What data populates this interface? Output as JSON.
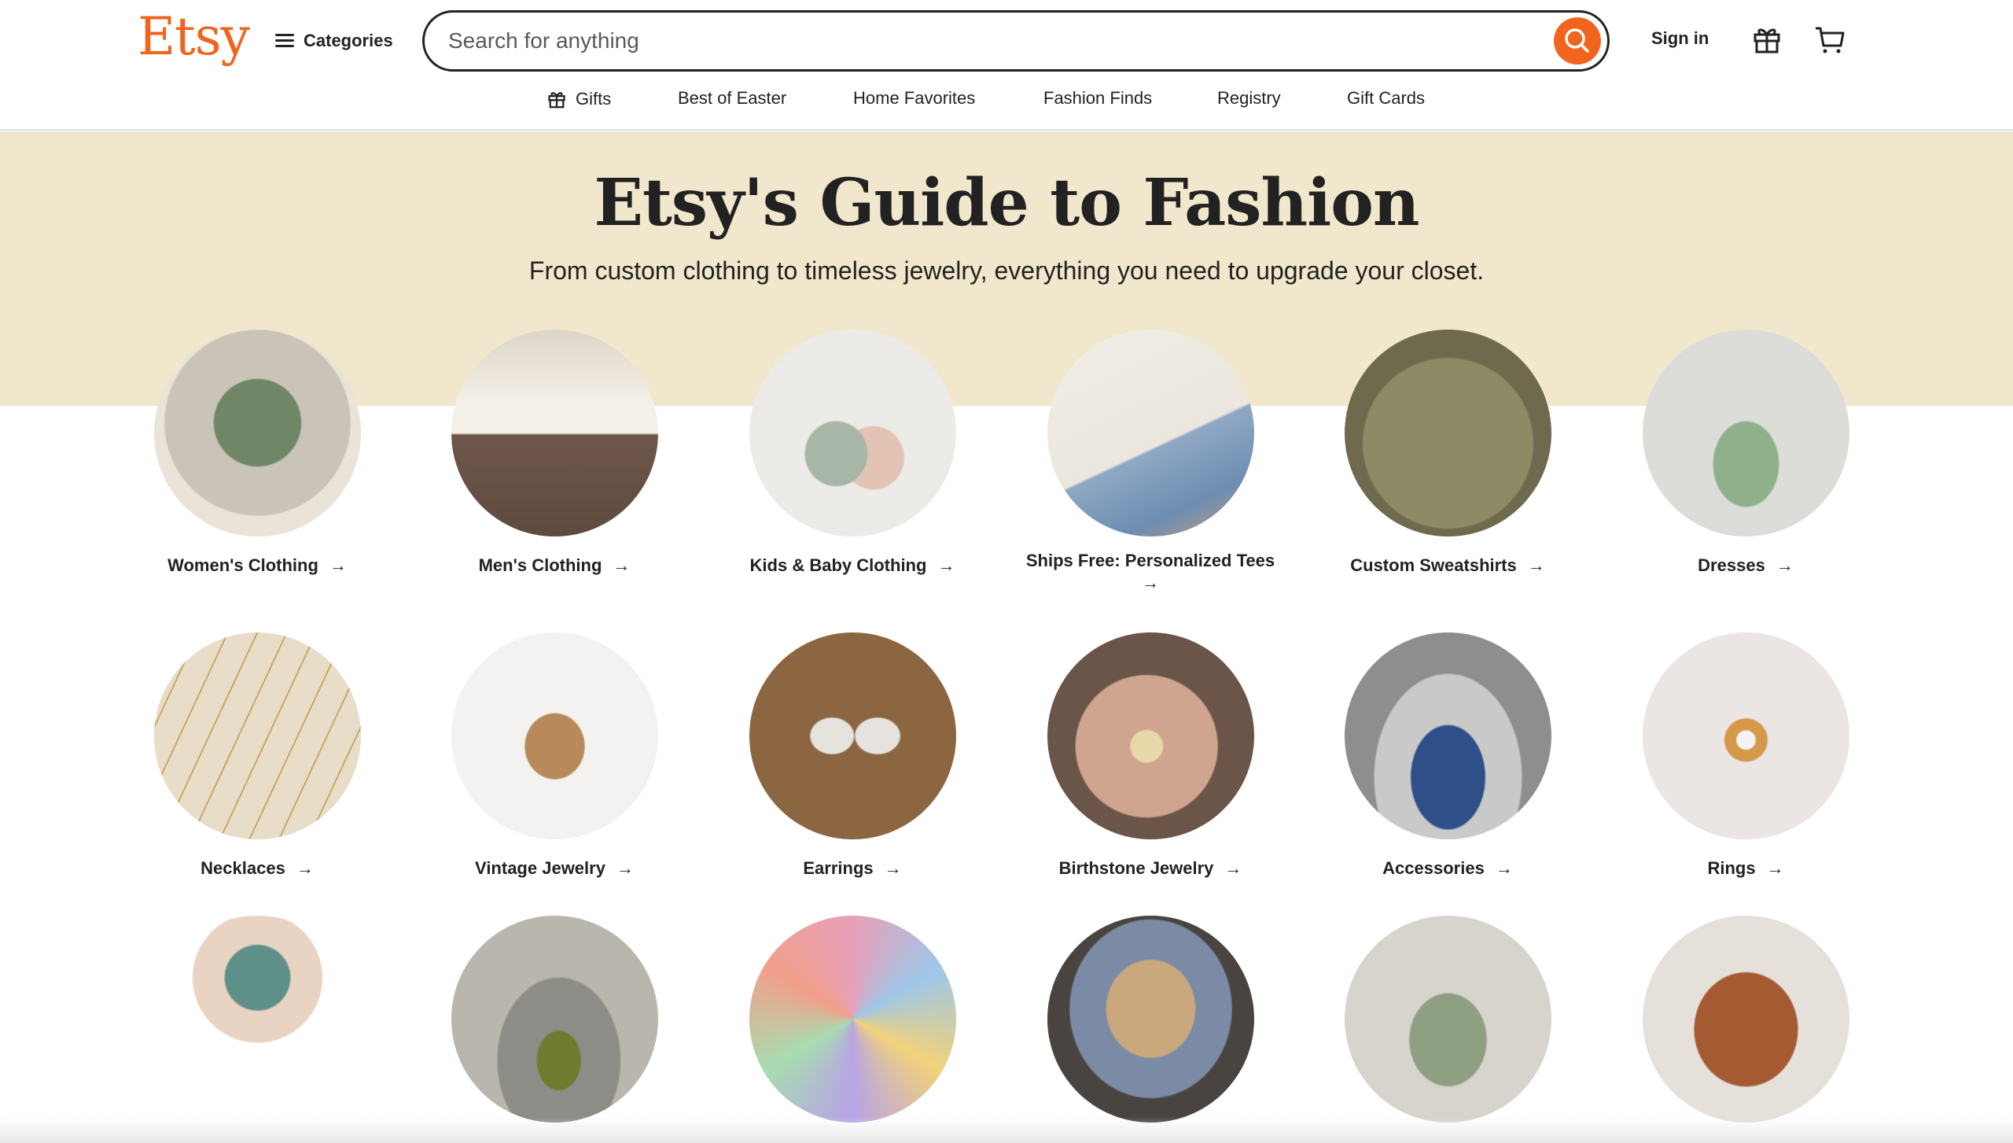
{
  "header": {
    "logo": "Etsy",
    "categories_label": "Categories",
    "search_placeholder": "Search for anything",
    "signin_label": "Sign in"
  },
  "subnav": {
    "items": [
      {
        "label": "Gifts",
        "icon": "gift-icon"
      },
      {
        "label": "Best of Easter"
      },
      {
        "label": "Home Favorites"
      },
      {
        "label": "Fashion Finds"
      },
      {
        "label": "Registry"
      },
      {
        "label": "Gift Cards"
      }
    ]
  },
  "hero": {
    "title": "Etsy's Guide to Fashion",
    "subtitle": "From custom clothing to timeless jewelry, everything you need to upgrade your closet."
  },
  "categories": [
    {
      "label": "Women's Clothing"
    },
    {
      "label": "Men's Clothing"
    },
    {
      "label": "Kids & Baby Clothing"
    },
    {
      "label": "Ships Free: Personalized Tees"
    },
    {
      "label": "Custom Sweatshirts"
    },
    {
      "label": "Dresses"
    },
    {
      "label": "Necklaces"
    },
    {
      "label": "Vintage Jewelry"
    },
    {
      "label": "Earrings"
    },
    {
      "label": "Birthstone Jewelry"
    },
    {
      "label": "Accessories"
    },
    {
      "label": "Rings"
    }
  ],
  "colors": {
    "brand": "#f1641e",
    "hero_bg": "#f1e7cc",
    "text": "#222222"
  }
}
